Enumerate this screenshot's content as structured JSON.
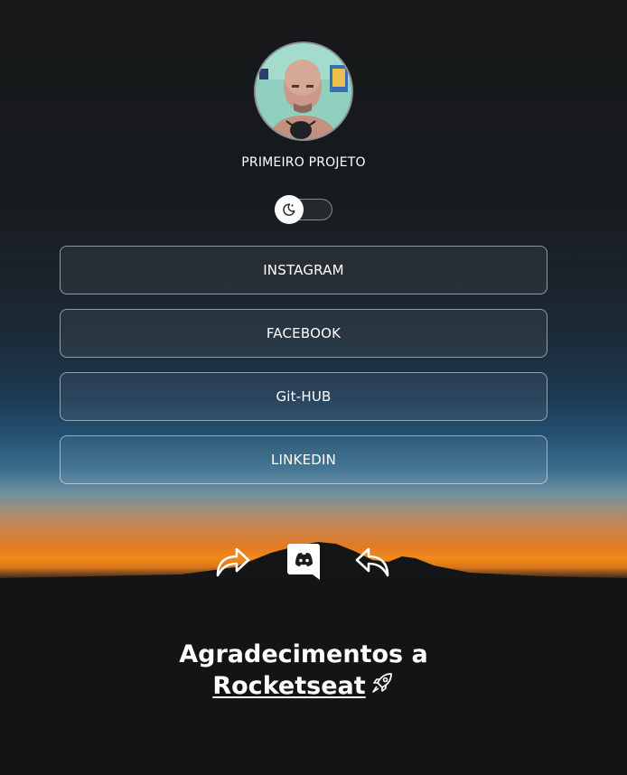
{
  "profile": {
    "title": "PRIMEIRO PROJETO",
    "avatar_alt": "Foto de perfil"
  },
  "theme_switch": {
    "icon": "moon-icon",
    "state": "off"
  },
  "links": [
    {
      "label": "INSTAGRAM"
    },
    {
      "label": "FACEBOOK"
    },
    {
      "label": "Git-HUB"
    },
    {
      "label": "LINKEDIN"
    }
  ],
  "social_icons": [
    "share-forward-icon",
    "discord-icon",
    "share-back-icon"
  ],
  "footer": {
    "line1": "Agradecimentos a",
    "link_label": "Rocketseat",
    "icon": "rocket-icon"
  },
  "colors": {
    "text": "#ffffff",
    "horizon_orange": "#f08a1a",
    "sky_blue": "#23506f",
    "background_dark": "#161819"
  }
}
